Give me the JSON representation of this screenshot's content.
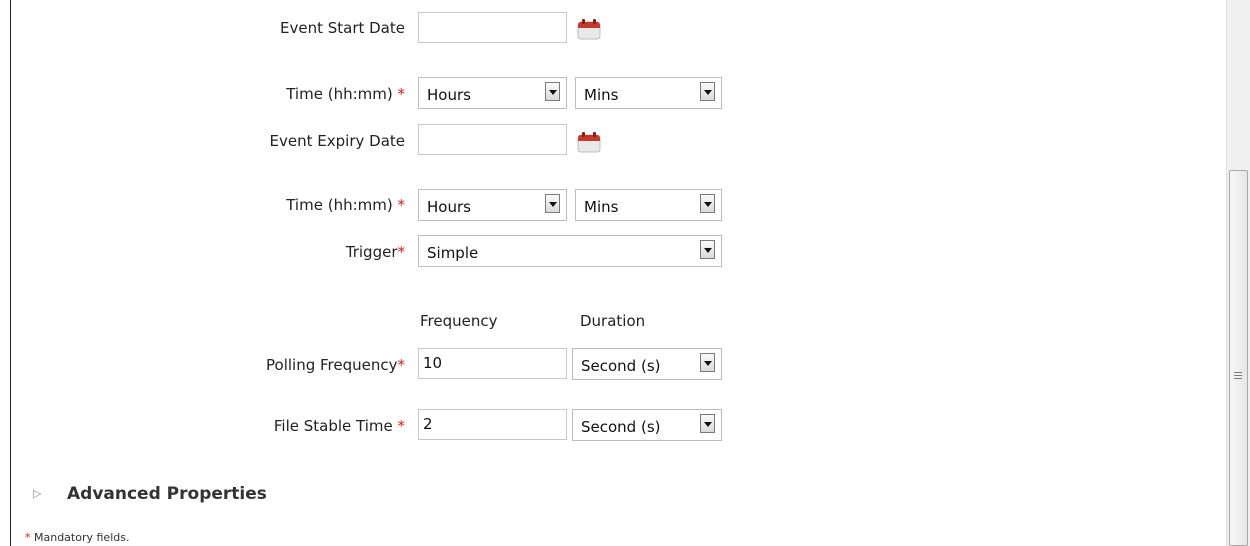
{
  "form": {
    "event_start_date_label": "Event Start Date",
    "event_start_date_value": "",
    "time_label": "Time  (hh:mm)",
    "required_mark": "*",
    "start_hours": "Hours",
    "start_mins": "Mins",
    "event_expiry_date_label": "Event Expiry Date",
    "event_expiry_date_value": "",
    "expiry_hours": "Hours",
    "expiry_mins": "Mins",
    "trigger_label": "Trigger",
    "trigger_value": "Simple",
    "frequency_header": "Frequency",
    "duration_header": "Duration",
    "polling_frequency_label": "Polling Frequency",
    "polling_frequency_value": "10",
    "polling_duration": "Second (s)",
    "file_stable_time_label": "File Stable Time ",
    "file_stable_time_value": "2",
    "file_stable_duration": "Second (s)"
  },
  "advanced": {
    "toggle_glyph": "▷",
    "title": "Advanced Properties"
  },
  "footer": {
    "mandatory_mark": "*",
    "mandatory_note": " Mandatory fields."
  },
  "colors": {
    "required": "#d0201a",
    "calendar_red": "#c23b2b"
  },
  "icons": {
    "calendar": "calendar-icon",
    "dropdown": "chevron-down-icon",
    "expand": "triangle-right-icon",
    "scroll_grip": "grip-icon"
  }
}
